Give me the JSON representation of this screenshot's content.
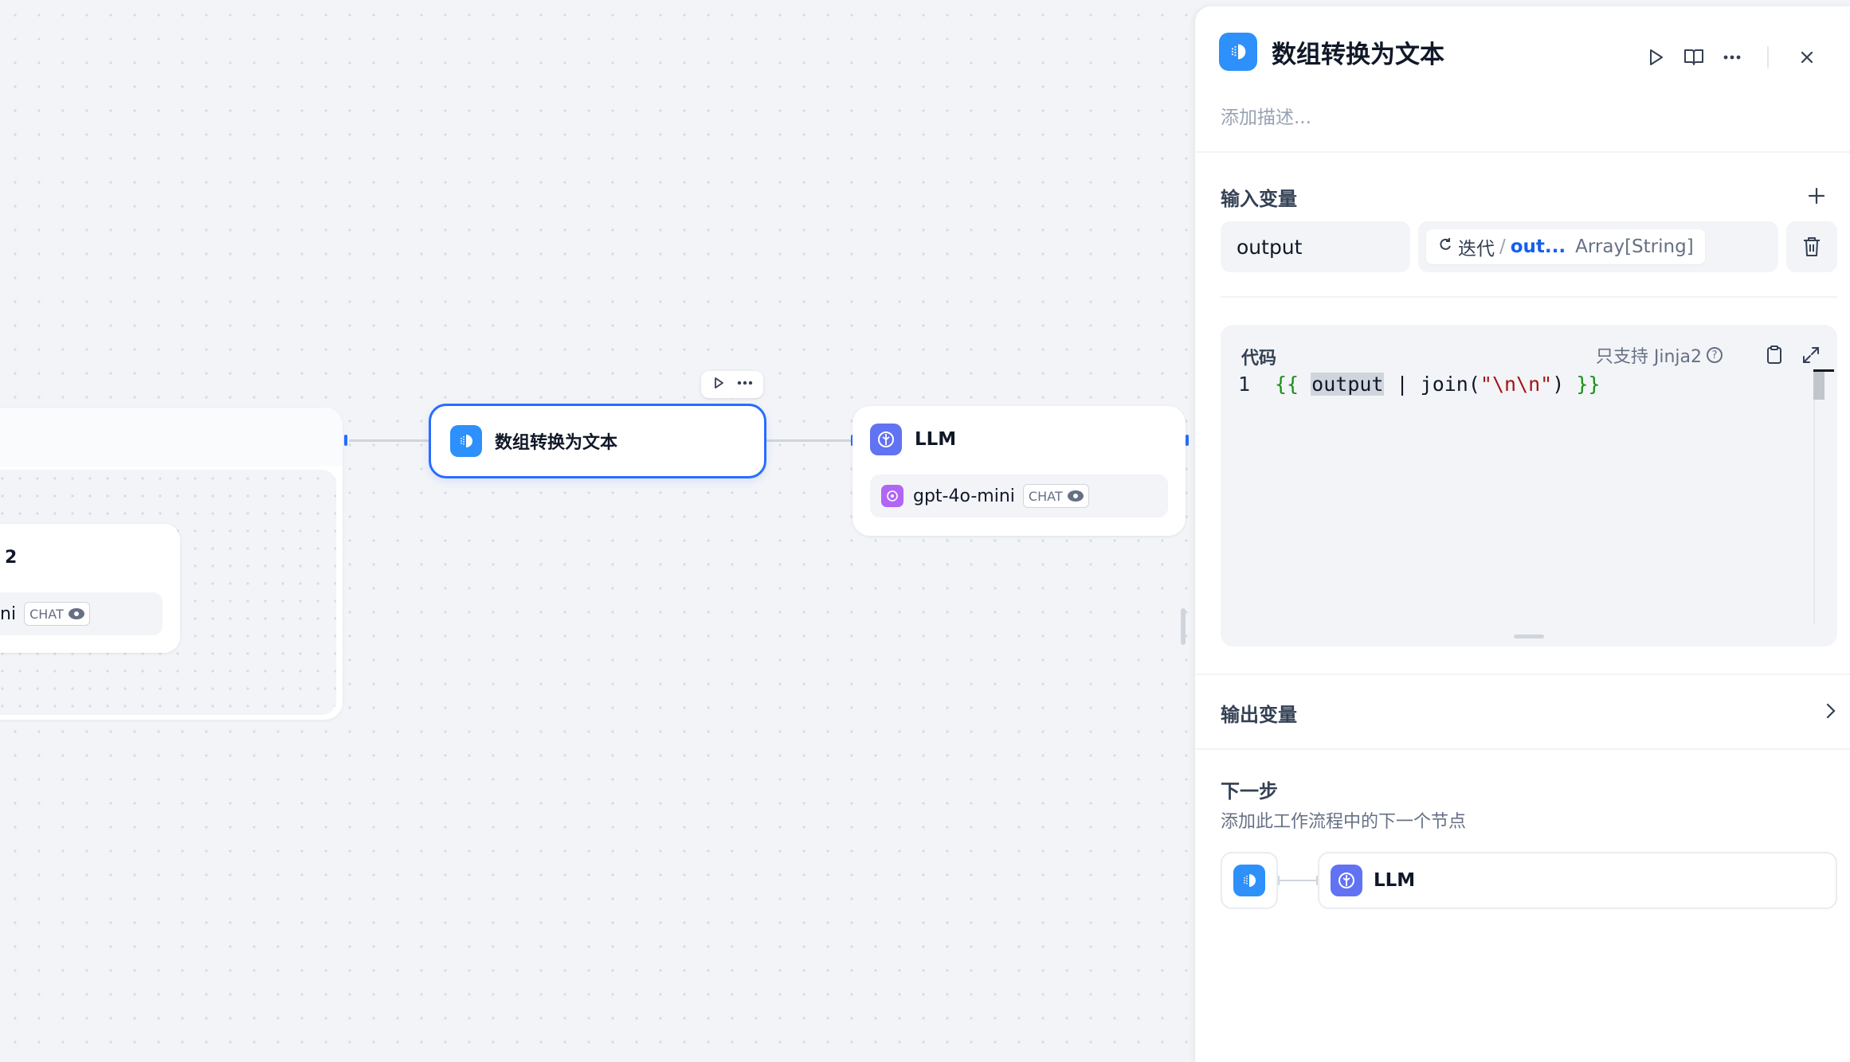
{
  "canvas": {
    "iteration_node": {
      "inner_llm": {
        "title": "2",
        "model": "ni",
        "badge": "CHAT"
      }
    },
    "selected_node": {
      "label": "数组转换为文本",
      "icon": "template-transform-icon"
    },
    "node_toolbar": {
      "run_icon": "play-icon",
      "more_icon": "more-icon"
    },
    "llm_node": {
      "label": "LLM",
      "model": "gpt-4o-mini",
      "badge": "CHAT",
      "icon": "llm-icon"
    }
  },
  "panel": {
    "title": "数组转换为文本",
    "description_placeholder": "添加描述...",
    "input_section": {
      "label": "输入变量",
      "variables": [
        {
          "name": "output",
          "source_node": "迭代",
          "source_var": "out...",
          "type": "Array[String]"
        }
      ]
    },
    "code_section": {
      "label": "代码",
      "hint": "只支持 Jinja2",
      "line_number": "1",
      "tokens": {
        "open": "{{",
        "var": "output",
        "pipe": " | join(",
        "str": "\"\\n\\n\"",
        "close_paren": ")",
        "close": "}}"
      }
    },
    "output_section": {
      "label": "输出变量"
    },
    "next_step": {
      "title": "下一步",
      "subtitle": "添加此工作流程中的下一个节点",
      "target_label": "LLM"
    }
  },
  "colors": {
    "accent": "#296dff",
    "node_blue": "#2e90fa",
    "node_purple": "#6172f3"
  }
}
